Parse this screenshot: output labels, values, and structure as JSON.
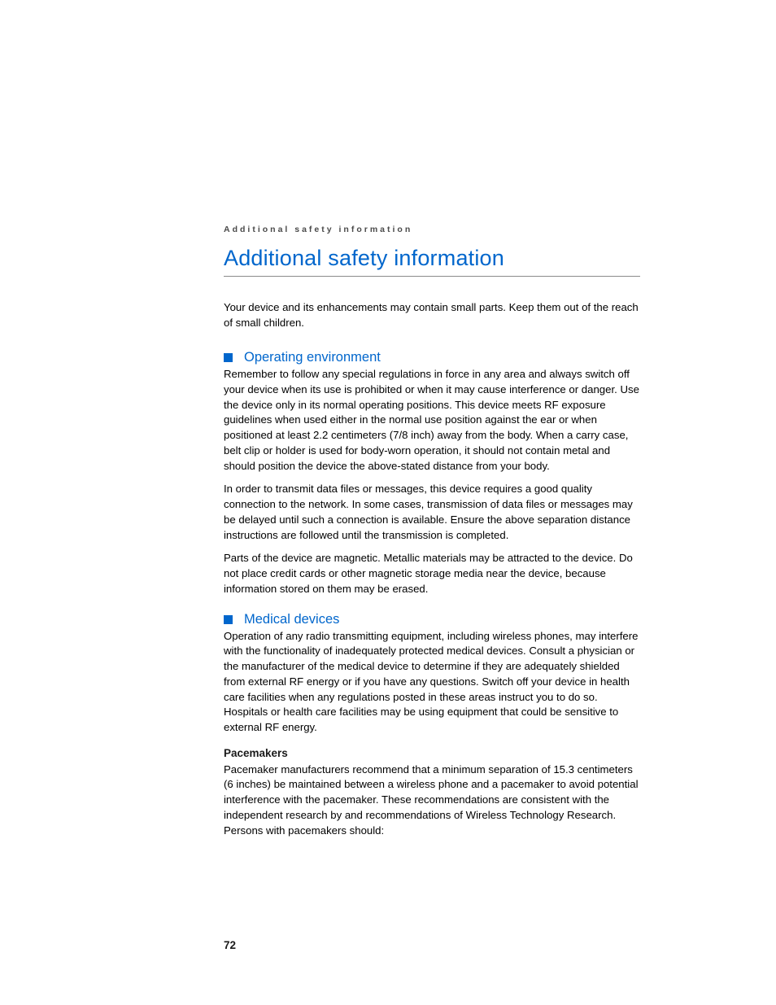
{
  "runningHeader": "Additional safety information",
  "title": "Additional safety information",
  "intro": "Your device and its enhancements may contain small parts. Keep them out of the reach of small children.",
  "section1": {
    "title": "Operating environment",
    "p1": "Remember to follow any special regulations in force in any area and always switch off your device when its use is prohibited or when it may cause interference or danger. Use the device only in its normal operating positions. This device meets RF exposure guidelines when used either in the normal use position against the ear or when positioned at least 2.2 centimeters (7/8 inch) away from the body. When a carry case, belt clip or holder is used for body-worn operation, it should not contain metal and should position the device the above-stated distance from your body.",
    "p2": "In order to transmit data files or messages, this device requires a good quality connection to the network. In some cases, transmission of data files or messages may be delayed until such a connection is available. Ensure the above separation distance instructions are followed until the transmission is completed.",
    "p3": "Parts of the device are magnetic. Metallic materials may be attracted to the device. Do not place credit cards or other magnetic storage media near the device, because information stored on them may be erased."
  },
  "section2": {
    "title": "Medical devices",
    "p1": "Operation of any radio transmitting equipment, including wireless phones, may interfere with the functionality of inadequately protected medical devices. Consult a physician or the manufacturer of the medical device to determine if they are adequately shielded from external RF energy or if you have any questions. Switch off your device in health care facilities when any regulations posted in these areas instruct you to do so. Hospitals or health care facilities may be using equipment that could be sensitive to external RF energy.",
    "sub1": {
      "title": "Pacemakers",
      "p1": "Pacemaker manufacturers recommend that a minimum separation of 15.3 centimeters (6 inches) be maintained between a wireless phone and a pacemaker to avoid potential interference with the pacemaker. These recommendations are consistent with the independent research by and recommendations of Wireless Technology Research. Persons with pacemakers should:"
    }
  },
  "pageNumber": "72"
}
